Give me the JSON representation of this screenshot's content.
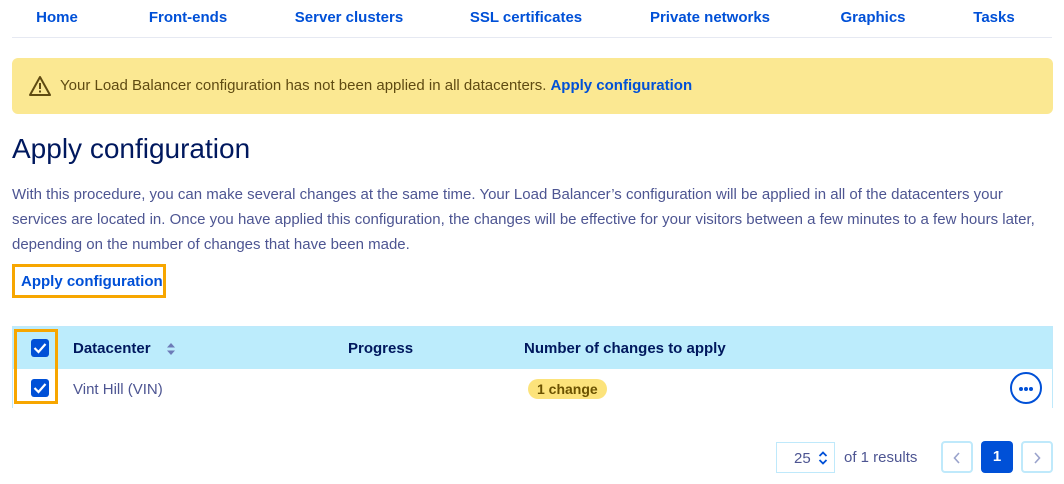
{
  "nav": {
    "tabs": [
      {
        "label": "Home"
      },
      {
        "label": "Front-ends"
      },
      {
        "label": "Server clusters"
      },
      {
        "label": "SSL certificates"
      },
      {
        "label": "Private networks"
      },
      {
        "label": "Graphics"
      },
      {
        "label": "Tasks"
      }
    ]
  },
  "banner": {
    "icon": "warning-icon",
    "message": "Your Load Balancer configuration has not been applied in all datacenters.",
    "link": "Apply configuration"
  },
  "page": {
    "title": "Apply configuration",
    "description": "With this procedure, you can make several changes at the same time. Your Load Balancer’s configuration will be applied in all of the datacenters your services are located in. Once you have applied this configuration, the changes will be effective for your visitors between a few minutes to a few hours later, depending on the number of changes that have been made.",
    "apply_button": "Apply configuration"
  },
  "table": {
    "columns": {
      "datacenter": "Datacenter",
      "progress": "Progress",
      "changes": "Number of changes to apply"
    },
    "select_all_checked": true,
    "rows": [
      {
        "checked": true,
        "datacenter": "Vint Hill (VIN)",
        "progress": "",
        "changes": "1 change"
      }
    ]
  },
  "pagination": {
    "page_size": "25",
    "results_text": "of 1 results",
    "current_page": "1"
  },
  "colors": {
    "accent": "#0050d7",
    "banner_bg": "#fbe892",
    "header_bg": "#bcecfc",
    "highlight": "#f7a600",
    "badge_bg": "#fce37b"
  }
}
